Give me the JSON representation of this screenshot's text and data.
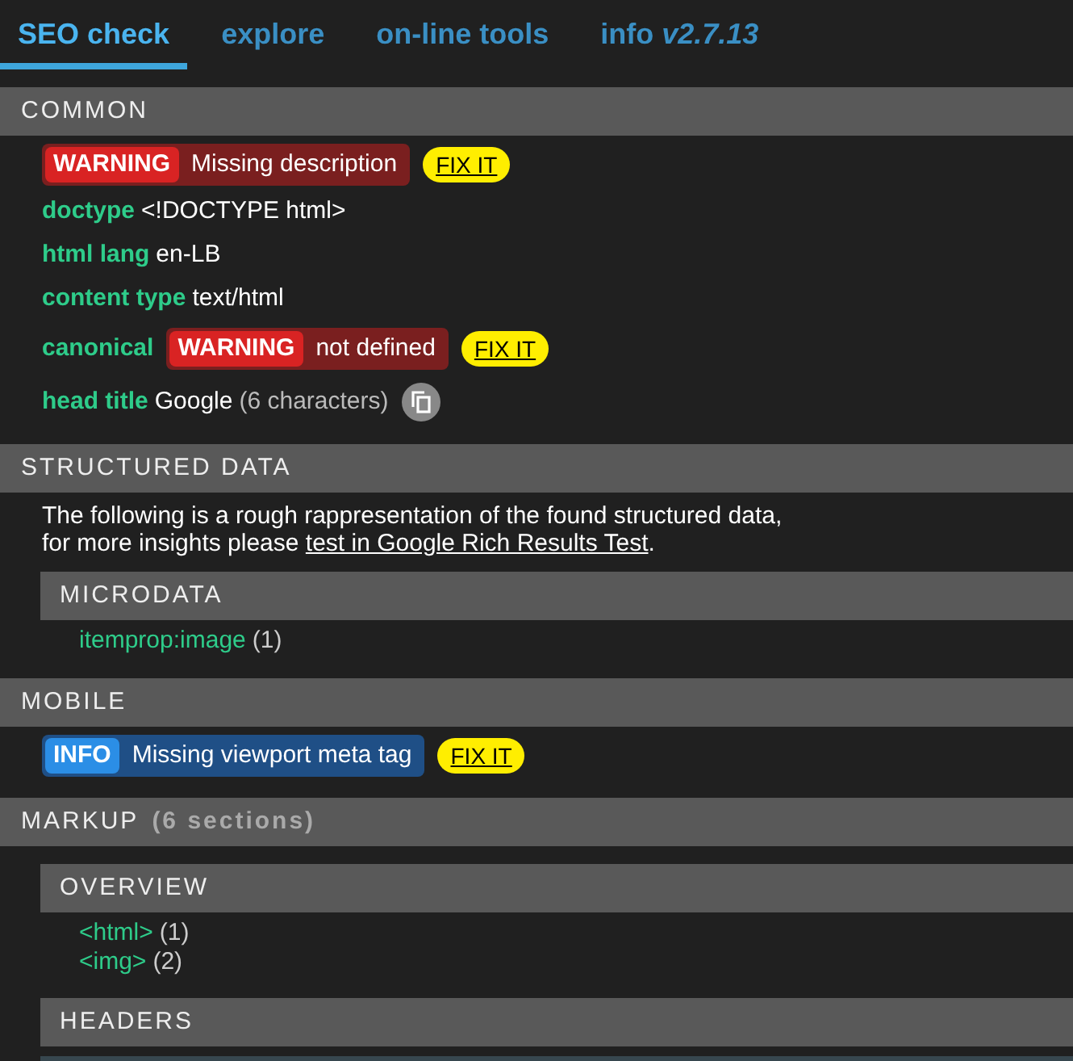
{
  "tabs": [
    {
      "label": "SEO check",
      "selected": true
    },
    {
      "label": "explore",
      "selected": false
    },
    {
      "label": "on-line tools",
      "selected": false
    },
    {
      "label": "info",
      "version": "v2.7.13",
      "selected": false
    }
  ],
  "sections": [
    {
      "title": "COMMON",
      "items": [
        {
          "kind": "alert",
          "color": "#d92323",
          "badge": "WARNING",
          "message": "Missing description",
          "action": "FIX IT"
        },
        {
          "kind": "field",
          "label": "doctype",
          "value": "<!DOCTYPE html>"
        },
        {
          "kind": "field",
          "label": "html lang",
          "value": "en-LB"
        },
        {
          "kind": "field",
          "label": "content type",
          "value": "text/html"
        },
        {
          "kind": "field_alert",
          "label": "canonical",
          "color": "#d92323",
          "badge": "WARNING",
          "message": "not defined",
          "action": "FIX IT"
        },
        {
          "kind": "field_copy",
          "label": "head title",
          "value": "Google",
          "note": "(6 characters)"
        }
      ]
    },
    {
      "title": "STRUCTURED DATA",
      "items": [
        {
          "kind": "paragraph",
          "lines": [
            "The following is a rough rappresentation of the found structured data,",
            "for more insights please "
          ],
          "link": "test in Google Rich Results Test",
          "after": "."
        },
        {
          "kind": "subsection",
          "title": "MICRODATA",
          "entries": [
            {
              "name": "itemprop:image",
              "count": "(1)"
            }
          ]
        }
      ]
    },
    {
      "title": "MOBILE",
      "items": [
        {
          "kind": "alert",
          "color": "#2b8ee6",
          "badge": "INFO",
          "message": "Missing viewport meta tag",
          "action": "FIX IT"
        }
      ]
    },
    {
      "title": "MARKUP",
      "note": "(6 sections)",
      "items": [
        {
          "kind": "subsection",
          "title": "OVERVIEW",
          "entries": [
            {
              "name": "<html>",
              "count": "(1)"
            },
            {
              "name": "<img>",
              "count": "(2)"
            }
          ]
        },
        {
          "kind": "subsection",
          "title": "HEADERS"
        }
      ]
    }
  ]
}
